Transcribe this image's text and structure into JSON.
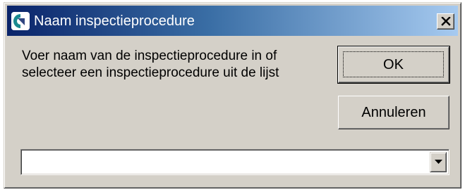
{
  "window": {
    "title": "Naam inspectieprocedure",
    "icon": "app-logo-icon",
    "close_icon": "close-icon"
  },
  "message": {
    "line1": "Voer naam van de inspectieprocedure in of",
    "line2": "selecteer een inspectieprocedure uit de lijst"
  },
  "buttons": {
    "ok_label": "OK",
    "cancel_label": "Annuleren"
  },
  "combo": {
    "value": "",
    "arrow_icon": "chevron-down-icon"
  },
  "colors": {
    "title_gradient_start": "#0a246a",
    "title_gradient_end": "#a6caf0",
    "face": "#d4d0c8"
  }
}
